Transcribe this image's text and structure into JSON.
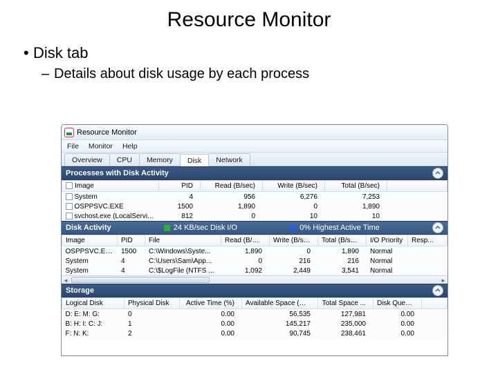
{
  "slide": {
    "title": "Resource Monitor",
    "bullet1": "Disk tab",
    "bullet2": "Details about disk usage by each process"
  },
  "window": {
    "title": "Resource Monitor",
    "menu": {
      "file": "File",
      "monitor": "Monitor",
      "help": "Help"
    },
    "tabs": {
      "overview": "Overview",
      "cpu": "CPU",
      "memory": "Memory",
      "disk": "Disk",
      "network": "Network"
    }
  },
  "section1": {
    "title": "Processes with Disk Activity",
    "cols": {
      "image": "Image",
      "pid": "PID",
      "read": "Read (B/sec)",
      "write": "Write (B/sec)",
      "total": "Total (B/sec)"
    },
    "rows": [
      {
        "image": "System",
        "pid": "4",
        "read": "956",
        "write": "6,276",
        "total": "7,253"
      },
      {
        "image": "OSPPSVC.EXE",
        "pid": "1500",
        "read": "1,890",
        "write": "0",
        "total": "1,890"
      },
      {
        "image": "svchost.exe (LocalServi...",
        "pid": "812",
        "read": "0",
        "write": "10",
        "total": "10"
      }
    ]
  },
  "section2": {
    "title": "Disk Activity",
    "mid1": "24 KB/sec Disk I/O",
    "mid2": "0% Highest Active Time",
    "cols": {
      "image": "Image",
      "pid": "PID",
      "file": "File",
      "read": "Read (B/sec)",
      "write": "Write (B/sec)",
      "total": "Total (B/sec)",
      "prio": "I/O Priority",
      "resp": "Resp..."
    },
    "rows": [
      {
        "image": "OSPPSVC.EXE",
        "pid": "1500",
        "file": "C:\\Windows\\Syste...",
        "read": "1,890",
        "write": "0",
        "total": "1,890",
        "prio": "Normal"
      },
      {
        "image": "System",
        "pid": "4",
        "file": "C:\\Users\\Sam\\App...",
        "read": "0",
        "write": "216",
        "total": "216",
        "prio": "Normal"
      },
      {
        "image": "System",
        "pid": "4",
        "file": "C:\\$LogFile (NTFS ...",
        "read": "1,092",
        "write": "2,449",
        "total": "3,541",
        "prio": "Normal"
      }
    ]
  },
  "section3": {
    "title": "Storage",
    "cols": {
      "logical": "Logical Disk",
      "physical": "Physical Disk",
      "active": "Active Time (%)",
      "avail": "Available Space (MB)",
      "total": "Total Space ...",
      "queue": "Disk Queu..."
    },
    "rows": [
      {
        "logical": "D: E: M: G:",
        "physical": "0",
        "active": "0.00",
        "avail": "56,535",
        "total": "127,981",
        "queue": "0.00"
      },
      {
        "logical": "B: H: I: C: J:",
        "physical": "1",
        "active": "0.00",
        "avail": "145,217",
        "total": "235,000",
        "queue": "0.00"
      },
      {
        "logical": "F: N: K:",
        "physical": "2",
        "active": "0.00",
        "avail": "90,745",
        "total": "238,461",
        "queue": "0.00"
      }
    ]
  }
}
